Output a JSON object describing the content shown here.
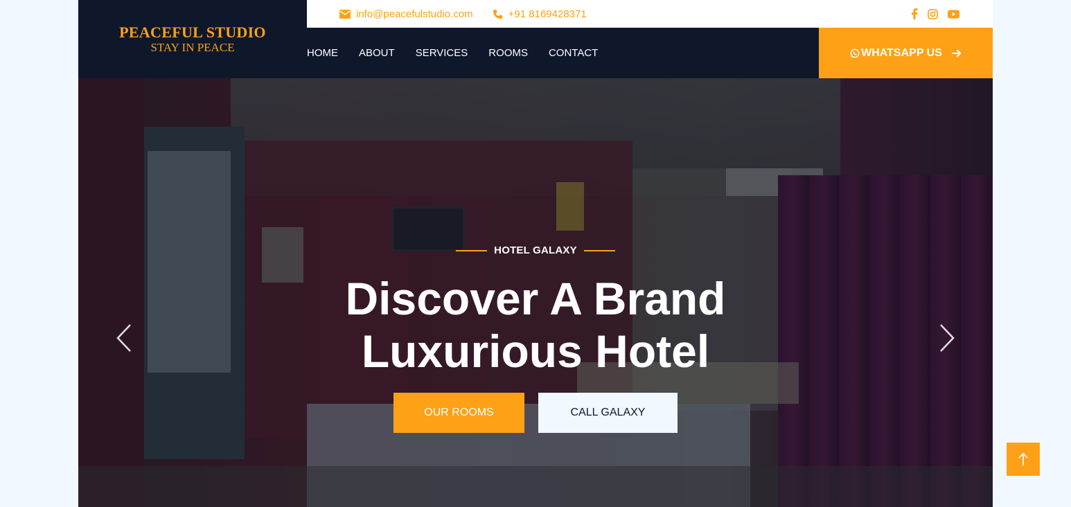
{
  "brand": {
    "title": "PEACEFUL STUDIO",
    "tagline": "STAY IN PEACE"
  },
  "topbar": {
    "email": "info@peacefulstudio.com",
    "phone": "+91 8169428371",
    "email_icon": "envelope-icon",
    "phone_icon": "phone-icon",
    "socials": [
      "facebook-icon",
      "instagram-icon",
      "youtube-icon"
    ]
  },
  "nav": {
    "items": [
      {
        "label": "HOME"
      },
      {
        "label": "ABOUT"
      },
      {
        "label": "SERVICES"
      },
      {
        "label": "ROOMS"
      },
      {
        "label": "CONTACT"
      }
    ],
    "cta_label": "WHATSAPP US",
    "cta_icons": [
      "whatsapp-icon",
      "arrow-right-icon"
    ]
  },
  "hero": {
    "subtitle": "HOTEL GALAXY",
    "title_line1": "Discover A Brand",
    "title_line2": "Luxurious Hotel",
    "primary_button": "OUR ROOMS",
    "secondary_button": "CALL GALAXY",
    "prev_icon": "chevron-left-icon",
    "next_icon": "chevron-right-icon"
  },
  "back_to_top_icon": "arrow-up-icon",
  "colors": {
    "accent": "#fea116",
    "dark": "#0f172b",
    "light": "#f1f8ff"
  }
}
